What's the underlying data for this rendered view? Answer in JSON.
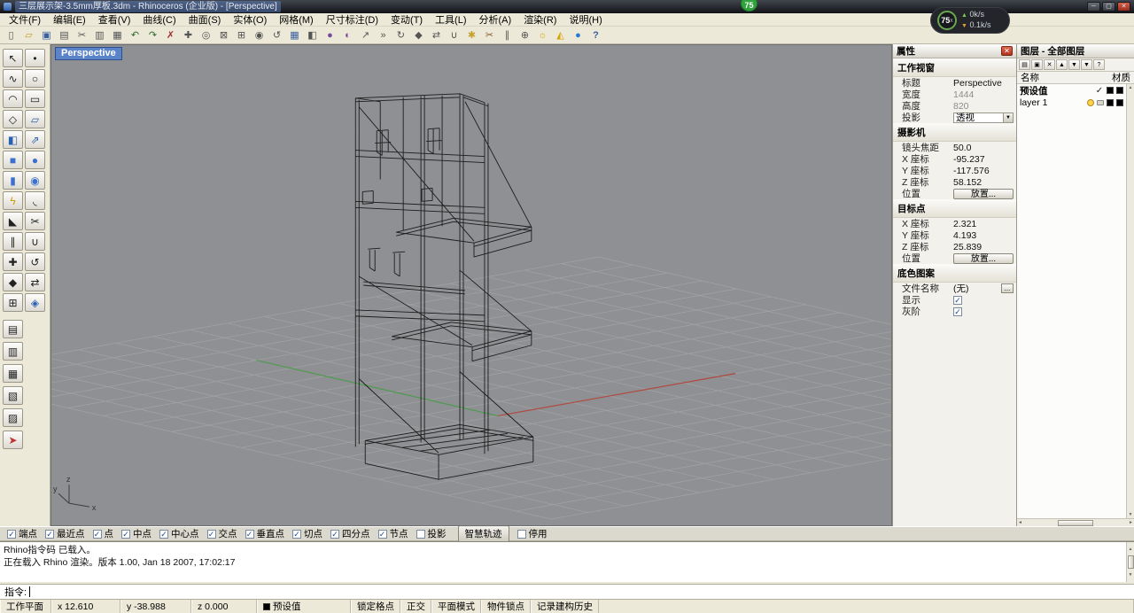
{
  "window": {
    "title": "三层展示架-3.5mm厚板.3dm - Rhinoceros (企业版) - [Perspective]",
    "minimize": "─",
    "maximize": "▢",
    "close": "✕"
  },
  "overlay": {
    "badge": "75",
    "monitor_value": "75",
    "monitor_suffix": "x",
    "up_arrow": "▲",
    "down_arrow": "▼",
    "monitor_up": "0k/s",
    "monitor_down": "0.1k/s"
  },
  "menubar": {
    "items": [
      {
        "name": "menu-file",
        "label": "文件(F)"
      },
      {
        "name": "menu-edit",
        "label": "编辑(E)"
      },
      {
        "name": "menu-view",
        "label": "查看(V)"
      },
      {
        "name": "menu-curve",
        "label": "曲线(C)"
      },
      {
        "name": "menu-surface",
        "label": "曲面(S)"
      },
      {
        "name": "menu-solid",
        "label": "实体(O)"
      },
      {
        "name": "menu-mesh",
        "label": "网格(M)"
      },
      {
        "name": "menu-dimension",
        "label": "尺寸标注(D)"
      },
      {
        "name": "menu-transform",
        "label": "变动(T)"
      },
      {
        "name": "menu-tools",
        "label": "工具(L)"
      },
      {
        "name": "menu-analyze",
        "label": "分析(A)"
      },
      {
        "name": "menu-render",
        "label": "渲染(R)"
      },
      {
        "name": "menu-help",
        "label": "说明(H)"
      }
    ]
  },
  "toolbar": {
    "icons": [
      {
        "name": "new-file-icon",
        "glyph": "▯",
        "style": "color:#555"
      },
      {
        "name": "open-file-icon",
        "glyph": "▱",
        "style": "color:#c79a2e"
      },
      {
        "name": "save-icon",
        "glyph": "▣",
        "style": "color:#3b5fa0"
      },
      {
        "name": "print-icon",
        "glyph": "▤",
        "style": "color:#555"
      },
      {
        "name": "cut-icon",
        "glyph": "✂",
        "style": "color:#555"
      },
      {
        "name": "copy-icon",
        "glyph": "▥",
        "style": "color:#555"
      },
      {
        "name": "paste-icon",
        "glyph": "▦",
        "style": "color:#555"
      },
      {
        "name": "undo-icon",
        "glyph": "↶",
        "style": "color:#2a6a2a"
      },
      {
        "name": "redo-icon",
        "glyph": "↷",
        "style": "color:#2a6a2a"
      },
      {
        "name": "delete-icon",
        "glyph": "✗",
        "style": "color:#a03030"
      },
      {
        "name": "pan-icon",
        "glyph": "✚",
        "style": "color:#555"
      },
      {
        "name": "zoom-dynamic-icon",
        "glyph": "◎",
        "style": "color:#555"
      },
      {
        "name": "zoom-window-icon",
        "glyph": "⊠",
        "style": "color:#555"
      },
      {
        "name": "zoom-extents-icon",
        "glyph": "⊞",
        "style": "color:#555"
      },
      {
        "name": "zoom-selected-icon",
        "glyph": "◉",
        "style": "color:#555"
      },
      {
        "name": "undo-view-icon",
        "glyph": "↺",
        "style": "color:#555"
      },
      {
        "name": "viewport-layout-icon",
        "glyph": "▦",
        "style": "color:#3b5fa0"
      },
      {
        "name": "shaded-view-icon",
        "glyph": "◧",
        "style": "color:#555"
      },
      {
        "name": "render-icon",
        "glyph": "●",
        "style": "color:#7a4a9a"
      },
      {
        "name": "render-preview-icon",
        "glyph": "◐",
        "style": "color:#7a4a9a"
      },
      {
        "name": "move-icon",
        "glyph": "↗",
        "style": "color:#555"
      },
      {
        "name": "copy-object-icon",
        "glyph": "»",
        "style": "color:#555"
      },
      {
        "name": "rotate-icon",
        "glyph": "↻",
        "style": "color:#555"
      },
      {
        "name": "scale-icon",
        "glyph": "◆",
        "style": "color:#555"
      },
      {
        "name": "mirror-icon",
        "glyph": "⇄",
        "style": "color:#555"
      },
      {
        "name": "join-icon",
        "glyph": "∪",
        "style": "color:#555"
      },
      {
        "name": "explode-icon",
        "glyph": "✱",
        "style": "color:#c7a12e"
      },
      {
        "name": "trim-icon",
        "glyph": "✂",
        "style": "color:#8a5a2a"
      },
      {
        "name": "split-icon",
        "glyph": "∥",
        "style": "color:#555"
      },
      {
        "name": "object-snap-icon",
        "glyph": "⊕",
        "style": "color:#555"
      },
      {
        "name": "lamp-icon",
        "glyph": "☼",
        "style": "color:#d8a400"
      },
      {
        "name": "spotlight-icon",
        "glyph": "◭",
        "style": "color:#d8a400"
      },
      {
        "name": "earth-icon",
        "glyph": "●",
        "style": "color:#2a7ad0"
      },
      {
        "name": "help-icon",
        "glyph": "?",
        "style": "color:#3b5fa0;font-weight:bold"
      }
    ]
  },
  "left_toolbar": {
    "grid": [
      {
        "name": "select-arrow-icon",
        "glyph": "↖",
        "style": "color:#222"
      },
      {
        "name": "point-icon",
        "glyph": "•",
        "style": "color:#222"
      },
      {
        "name": "curve-freeform-icon",
        "glyph": "∿",
        "style": "color:#222"
      },
      {
        "name": "circle-icon",
        "glyph": "○",
        "style": "color:#222"
      },
      {
        "name": "arc-icon",
        "glyph": "◠",
        "style": "color:#222"
      },
      {
        "name": "rectangle-icon",
        "glyph": "▭",
        "style": "color:#222"
      },
      {
        "name": "polygon-icon",
        "glyph": "◇",
        "style": "color:#222"
      },
      {
        "name": "surface-plane-icon",
        "glyph": "▱",
        "style": "color:#2b5fb0"
      },
      {
        "name": "loft-surface-icon",
        "glyph": "◧",
        "style": "color:#2b5fb0"
      },
      {
        "name": "extrude-surface-icon",
        "glyph": "⇗",
        "style": "color:#2b5fb0"
      },
      {
        "name": "box-solid-icon",
        "glyph": "■",
        "style": "color:#3b6fd0"
      },
      {
        "name": "sphere-solid-icon",
        "glyph": "●",
        "style": "color:#3b6fd0"
      },
      {
        "name": "cylinder-solid-icon",
        "glyph": "▮",
        "style": "color:#3b6fd0"
      },
      {
        "name": "boolean-union-icon",
        "glyph": "◉",
        "style": "color:#3b6fd0"
      },
      {
        "name": "explode-tool-icon",
        "glyph": "ϟ",
        "style": "color:#d09a10"
      },
      {
        "name": "fillet-curve-icon",
        "glyph": "◟",
        "style": "color:#222"
      },
      {
        "name": "chamfer-icon",
        "glyph": "◣",
        "style": "color:#222"
      },
      {
        "name": "trim-tool-icon",
        "glyph": "✂",
        "style": "color:#222"
      },
      {
        "name": "split-tool-icon",
        "glyph": "∥",
        "style": "color:#222"
      },
      {
        "name": "join-tool-icon",
        "glyph": "∪",
        "style": "color:#222"
      },
      {
        "name": "move-tool-icon",
        "glyph": "✚",
        "style": "color:#222"
      },
      {
        "name": "rotate-tool-icon",
        "glyph": "↺",
        "style": "color:#222"
      },
      {
        "name": "scale-tool-icon",
        "glyph": "◆",
        "style": "color:#222"
      },
      {
        "name": "mirror-tool-icon",
        "glyph": "⇄",
        "style": "color:#222"
      },
      {
        "name": "array-tool-icon",
        "glyph": "⊞",
        "style": "color:#222"
      },
      {
        "name": "curve-boolean-icon",
        "glyph": "◈",
        "style": "color:#2b5fb0"
      }
    ],
    "extra": [
      {
        "name": "cplane-icon",
        "glyph": "▤",
        "style": "color:#222"
      },
      {
        "name": "display-mode-icon",
        "glyph": "▥",
        "style": "color:#222"
      },
      {
        "name": "layer-tool-icon",
        "glyph": "▦",
        "style": "color:#222"
      },
      {
        "name": "notes-icon",
        "glyph": "▧",
        "style": "color:#222"
      },
      {
        "name": "properties-tool-icon",
        "glyph": "▨",
        "style": "color:#222"
      },
      {
        "name": "analyze-direction-icon",
        "glyph": "➤",
        "style": "color:#c03030"
      }
    ]
  },
  "viewport": {
    "label": "Perspective",
    "axis_x": "x",
    "axis_y": "y",
    "axis_z": "z"
  },
  "props": {
    "title": "属性",
    "viewport_section": "工作视窗",
    "rows": {
      "title": {
        "label": "标题",
        "value": "Perspective"
      },
      "width": {
        "label": "宽度",
        "value": "1444"
      },
      "height": {
        "label": "高度",
        "value": "820"
      },
      "projection": {
        "label": "投影",
        "value": "透视",
        "arrow": "▼"
      }
    },
    "camera_section": "摄影机",
    "camera": {
      "focal": {
        "label": "镜头焦距",
        "value": "50.0"
      },
      "x": {
        "label": "X 座标",
        "value": "-95.237"
      },
      "y": {
        "label": "Y 座标",
        "value": "-117.576"
      },
      "z": {
        "label": "Z 座标",
        "value": "58.152"
      },
      "place": {
        "label": "位置",
        "button": "放置..."
      }
    },
    "target_section": "目标点",
    "target": {
      "x": {
        "label": "X 座标",
        "value": "2.321"
      },
      "y": {
        "label": "Y 座标",
        "value": "4.193"
      },
      "z": {
        "label": "Z 座标",
        "value": "25.839"
      },
      "place": {
        "label": "位置",
        "button": "放置..."
      }
    },
    "background_section": "底色图案",
    "background": {
      "filename": {
        "label": "文件名称",
        "value": "(无)",
        "browse": "..."
      },
      "show": {
        "label": "显示",
        "check": "✓"
      },
      "gray": {
        "label": "灰阶",
        "check": "✓"
      }
    }
  },
  "layers": {
    "title": "图层 - 全部图层",
    "toolbar": [
      {
        "name": "new-layer-icon",
        "glyph": "▤"
      },
      {
        "name": "new-sublayer-icon",
        "glyph": "▣"
      },
      {
        "name": "delete-layer-icon",
        "glyph": "✕"
      },
      {
        "name": "move-up-icon",
        "glyph": "▲"
      },
      {
        "name": "move-down-icon",
        "glyph": "▼"
      },
      {
        "name": "filter-icon",
        "glyph": "▼"
      },
      {
        "name": "layers-help-icon",
        "glyph": "?"
      }
    ],
    "columns": {
      "name": "名称",
      "material": "材质"
    },
    "rows": [
      {
        "name": "预设值",
        "current": "✓"
      },
      {
        "name": "layer 1",
        "current": ""
      }
    ]
  },
  "osnap": {
    "items": [
      {
        "name": "osnap-end",
        "label": "端点",
        "check": "✓"
      },
      {
        "name": "osnap-near",
        "label": "最近点",
        "check": "✓"
      },
      {
        "name": "osnap-point",
        "label": "点",
        "check": "✓"
      },
      {
        "name": "osnap-mid",
        "label": "中点",
        "check": "✓"
      },
      {
        "name": "osnap-center",
        "label": "中心点",
        "check": "✓"
      },
      {
        "name": "osnap-intersection",
        "label": "交点",
        "check": "✓"
      },
      {
        "name": "osnap-perpendicular",
        "label": "垂直点",
        "check": "✓"
      },
      {
        "name": "osnap-tangent",
        "label": "切点",
        "check": "✓"
      },
      {
        "name": "osnap-quadrant",
        "label": "四分点",
        "check": "✓"
      },
      {
        "name": "osnap-knot",
        "label": "节点",
        "check": "✓"
      },
      {
        "name": "osnap-project",
        "label": "投影",
        "check": ""
      }
    ],
    "smart_track": "智慧轨迹",
    "disable": "停用"
  },
  "command": {
    "history_line1": "Rhino指令码 已载入。",
    "history_line2": "正在载入 Rhino 渲染。版本 1.00, Jan 18 2007, 17:02:17",
    "prompt": "指令:"
  },
  "statusbar": {
    "cplane": "工作平面",
    "x": "x 12.610",
    "y": "y -38.988",
    "z": "z 0.000",
    "layer": "预设值",
    "toggles": [
      {
        "name": "pane-grid-snap",
        "label": "锁定格点"
      },
      {
        "name": "pane-ortho",
        "label": "正交"
      },
      {
        "name": "pane-planar",
        "label": "平面模式"
      },
      {
        "name": "pane-osnap",
        "label": "物件锁点"
      },
      {
        "name": "pane-record-history",
        "label": "记录建构历史"
      }
    ]
  }
}
